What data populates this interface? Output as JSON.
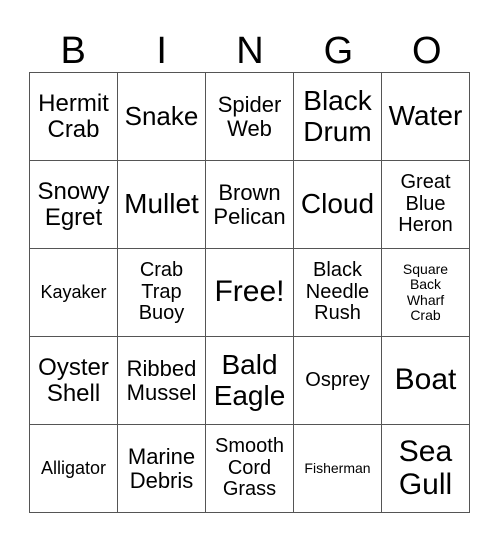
{
  "header": [
    "B",
    "I",
    "N",
    "G",
    "O"
  ],
  "rows": [
    [
      "Hermit\nCrab",
      "Snake",
      "Spider\nWeb",
      "Black\nDrum",
      "Water"
    ],
    [
      "Snowy\nEgret",
      "Mullet",
      "Brown\nPelican",
      "Cloud",
      "Great\nBlue\nHeron"
    ],
    [
      "Kayaker",
      "Crab\nTrap\nBuoy",
      "Free!",
      "Black\nNeedle\nRush",
      "Square\nBack\nWharf\nCrab"
    ],
    [
      "Oyster\nShell",
      "Ribbed\nMussel",
      "Bald\nEagle",
      "Osprey",
      "Boat"
    ],
    [
      "Alligator",
      "Marine\nDebris",
      "Smooth\nCord\nGrass",
      "Fisherman",
      "Sea\nGull"
    ]
  ]
}
